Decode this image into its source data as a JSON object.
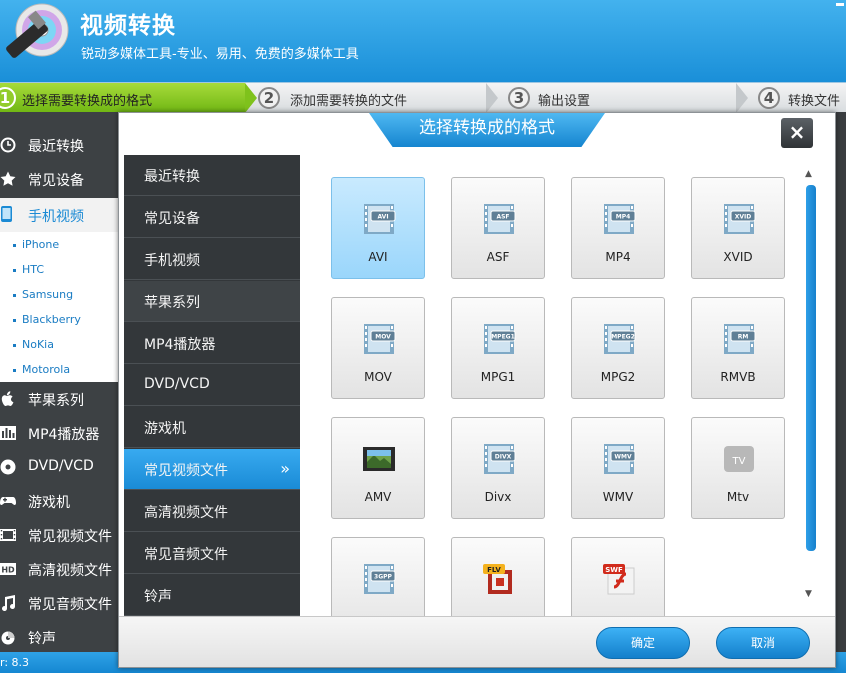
{
  "app": {
    "title": "视频转换",
    "subtitle": "锐动多媒体工具-专业、易用、免费的多媒体工具",
    "version": "r: 8.3"
  },
  "steps": [
    {
      "num": "1",
      "label": "选择需要转换成的格式"
    },
    {
      "num": "2",
      "label": "添加需要转换的文件"
    },
    {
      "num": "3",
      "label": "输出设置"
    },
    {
      "num": "4",
      "label": "转换文件"
    }
  ],
  "sidebar": {
    "items": [
      {
        "label": "最近转换",
        "icon": "clock-icon"
      },
      {
        "label": "常见设备",
        "icon": "star-icon"
      },
      {
        "label": "手机视频",
        "icon": "phone-icon"
      },
      {
        "label": "苹果系列",
        "icon": "apple-icon"
      },
      {
        "label": "MP4播放器",
        "icon": "mp4-player-icon"
      },
      {
        "label": "DVD/VCD",
        "icon": "disc-icon"
      },
      {
        "label": "游戏机",
        "icon": "gamepad-icon"
      },
      {
        "label": "常见视频文件",
        "icon": "film-icon"
      },
      {
        "label": "高清视频文件",
        "icon": "hd-icon"
      },
      {
        "label": "常见音频文件",
        "icon": "music-icon"
      },
      {
        "label": "铃声",
        "icon": "bell-icon"
      }
    ],
    "phone_sub_items": [
      "iPhone",
      "HTC",
      "Samsung",
      "Blackberry",
      "NoKia",
      "Motorola"
    ]
  },
  "dialog": {
    "title": "选择转换成的格式",
    "close": "×",
    "categories": [
      "最近转换",
      "常见设备",
      "手机视频",
      "苹果系列",
      "MP4播放器",
      "DVD/VCD",
      "游戏机",
      "常见视频文件",
      "高清视频文件",
      "常见音频文件",
      "铃声"
    ],
    "selected_category": "常见视频文件",
    "chevron": "»",
    "formats": [
      {
        "label": "AVI",
        "tag": "AVI",
        "icon": "film-format-icon"
      },
      {
        "label": "ASF",
        "tag": "ASF",
        "icon": "film-format-icon"
      },
      {
        "label": "MP4",
        "tag": "MP4",
        "icon": "film-format-icon"
      },
      {
        "label": "XVID",
        "tag": "XVID",
        "icon": "film-format-icon"
      },
      {
        "label": "MOV",
        "tag": "MOV",
        "icon": "film-format-icon"
      },
      {
        "label": "MPG1",
        "tag": "MPEG1",
        "icon": "film-format-icon"
      },
      {
        "label": "MPG2",
        "tag": "MPEG2",
        "icon": "film-format-icon"
      },
      {
        "label": "RMVB",
        "tag": "RM",
        "icon": "film-format-icon"
      },
      {
        "label": "AMV",
        "tag": "",
        "icon": "amv-film-icon"
      },
      {
        "label": "Divx",
        "tag": "DIVX",
        "icon": "film-format-icon"
      },
      {
        "label": "WMV",
        "tag": "WMV",
        "icon": "film-format-icon"
      },
      {
        "label": "Mtv",
        "tag": "TV",
        "icon": "apple-tv-icon"
      },
      {
        "label": "",
        "tag": "3GPP",
        "icon": "film-format-icon"
      },
      {
        "label": "",
        "tag": "FLV",
        "icon": "flv-icon"
      },
      {
        "label": "",
        "tag": "SWF",
        "icon": "swf-icon"
      }
    ],
    "selected_format": "AVI",
    "confirm": "确定",
    "cancel": "取消"
  },
  "colors": {
    "accent_blue": "#1a8fd8",
    "step_active_green": "#8bc926",
    "sidebar_dark": "#3d4144",
    "selected_tile": "#b4e1fd"
  }
}
